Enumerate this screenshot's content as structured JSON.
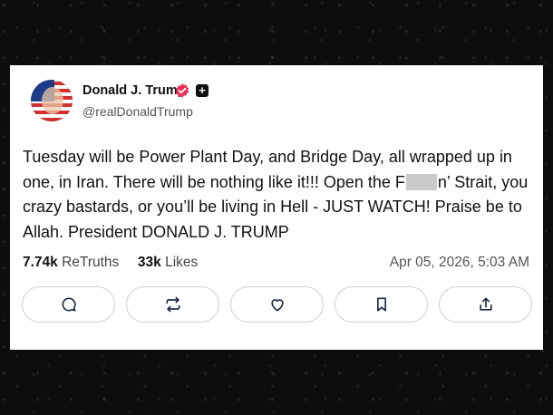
{
  "post": {
    "author_name": "Donald J. Trump",
    "handle": "@realDonaldTrump",
    "text_part1": "Tuesday will be Power Plant Day, and Bridge Day, all wrapped up in one, in Iran. There will be nothing like it!!! Open the F",
    "text_part2": "n’ Strait, you crazy bastards, or you’ll be living in Hell - JUST WATCH! Praise be to Allah. President DONALD J. TRUMP",
    "retruths_count": "7.74k",
    "retruths_label": "ReTruths",
    "likes_count": "33k",
    "likes_label": "Likes",
    "timestamp": "Apr 05, 2026, 5:03 AM"
  },
  "colors": {
    "verified_badge": "#e7335a",
    "plus_badge": "#111111",
    "button_border": "#cfcfcf",
    "icon_color": "#1f2a44"
  },
  "icons": [
    "comment-icon",
    "retruth-icon",
    "like-icon",
    "bookmark-icon",
    "share-icon"
  ]
}
